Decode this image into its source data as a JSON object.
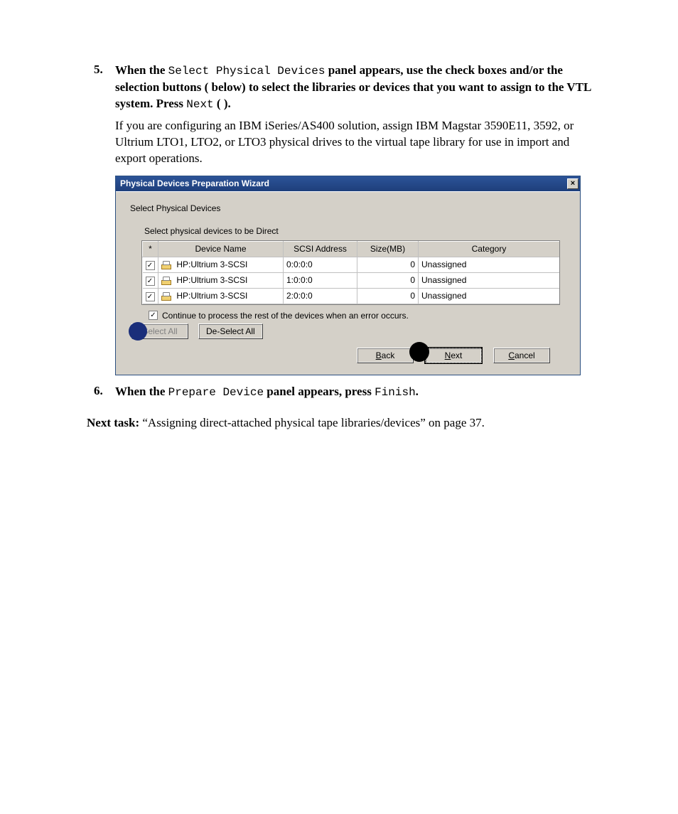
{
  "steps": {
    "item5": {
      "number": "5.",
      "lead_a": "When the ",
      "lead_code": "Select Physical Devices",
      "lead_b": " panel appears, use the check boxes and/or the selection buttons (   below) to select the libraries or devices that you want to assign to the VTL system. Press ",
      "lead_code2": "Next",
      "lead_c": " (  ).",
      "para": "If you are configuring an IBM iSeries/AS400 solution, assign IBM Magstar 3590E11, 3592, or Ultrium LTO1, LTO2, or LTO3 physical drives to the virtual tape library for use in import and export operations."
    },
    "item6": {
      "number": "6.",
      "lead_a": "When the ",
      "lead_code": "Prepare Device",
      "lead_b": " panel appears, press ",
      "lead_code2": "Finish",
      "lead_c": "."
    }
  },
  "next_task": {
    "label": "Next task:",
    "text": "  “Assigning direct-attached physical tape libraries/devices” on page 37."
  },
  "dialog": {
    "title": "Physical Devices Preparation Wizard",
    "close": "×",
    "subtitle": "Select Physical Devices",
    "section_label": "Select physical devices to be Direct",
    "columns": {
      "star": "*",
      "name": "Device Name",
      "scsi": "SCSI Address",
      "size": "Size(MB)",
      "category": "Category"
    },
    "rows": [
      {
        "checked": true,
        "name": "HP:Ultrium 3-SCSI",
        "scsi": "0:0:0:0",
        "size": "0",
        "category": "Unassigned"
      },
      {
        "checked": true,
        "name": "HP:Ultrium 3-SCSI",
        "scsi": "1:0:0:0",
        "size": "0",
        "category": "Unassigned"
      },
      {
        "checked": true,
        "name": "HP:Ultrium 3-SCSI",
        "scsi": "2:0:0:0",
        "size": "0",
        "category": "Unassigned"
      }
    ],
    "continue_checked": true,
    "continue_label": "Continue to process the rest of the devices when an error occurs.",
    "buttons": {
      "select_all": "Select All",
      "deselect_all": "De-Select All",
      "back_u": "B",
      "back_rest": "ack",
      "next_u": "N",
      "next_rest": "ext",
      "cancel_u": "C",
      "cancel_rest": "ancel"
    }
  }
}
